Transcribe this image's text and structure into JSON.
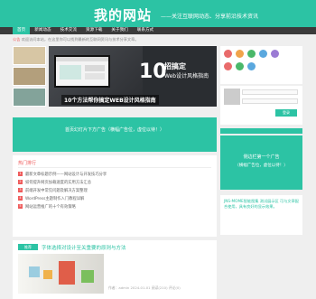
{
  "header": {
    "logo": "我的网站",
    "tagline": "——关注互联网动态、分享前沿技术资讯"
  },
  "nav": [
    "首页",
    "新闻动态",
    "技术交流",
    "资源下载",
    "关于我们",
    "联系方式"
  ],
  "notice": {
    "label": "公告",
    "text": "欢迎访问本站，在这里你可以找到最新的互联网资讯与技术分享文章。"
  },
  "banner": {
    "number": "10",
    "title_line1": "招搞定",
    "title_line2": "Web设计风格指南",
    "caption": "10个方法帮你搞定WEB设计风格指南"
  },
  "ad_main": "首页幻灯片下方广告（横幅广告位，虚位以待！）",
  "hot": {
    "title": "热门排行",
    "items": [
      "最新文章标题示例——网站设计与开发技巧分享",
      "如何提升网页加载速度的实用方法汇总",
      "前端开发中常见问题及解决方案整理",
      "WordPress主题制作入门教程详解",
      "网站运营推广的十个有效策略"
    ]
  },
  "post": {
    "tag": "推荐",
    "title": "字体选择对设计至关重要的原则与方法",
    "meta": "作者：admin  2024-01-01  阅读(210)  评论(0)"
  },
  "sidebar": {
    "login_button": "登录",
    "ad_line1": "侧边栏第一个广告",
    "ad_line2": "（横幅广告位，虚位以待！）",
    "text": "JNS-MOME智能图集 测试展示区 可与文章配合使用，具有良好的显示效果。"
  }
}
